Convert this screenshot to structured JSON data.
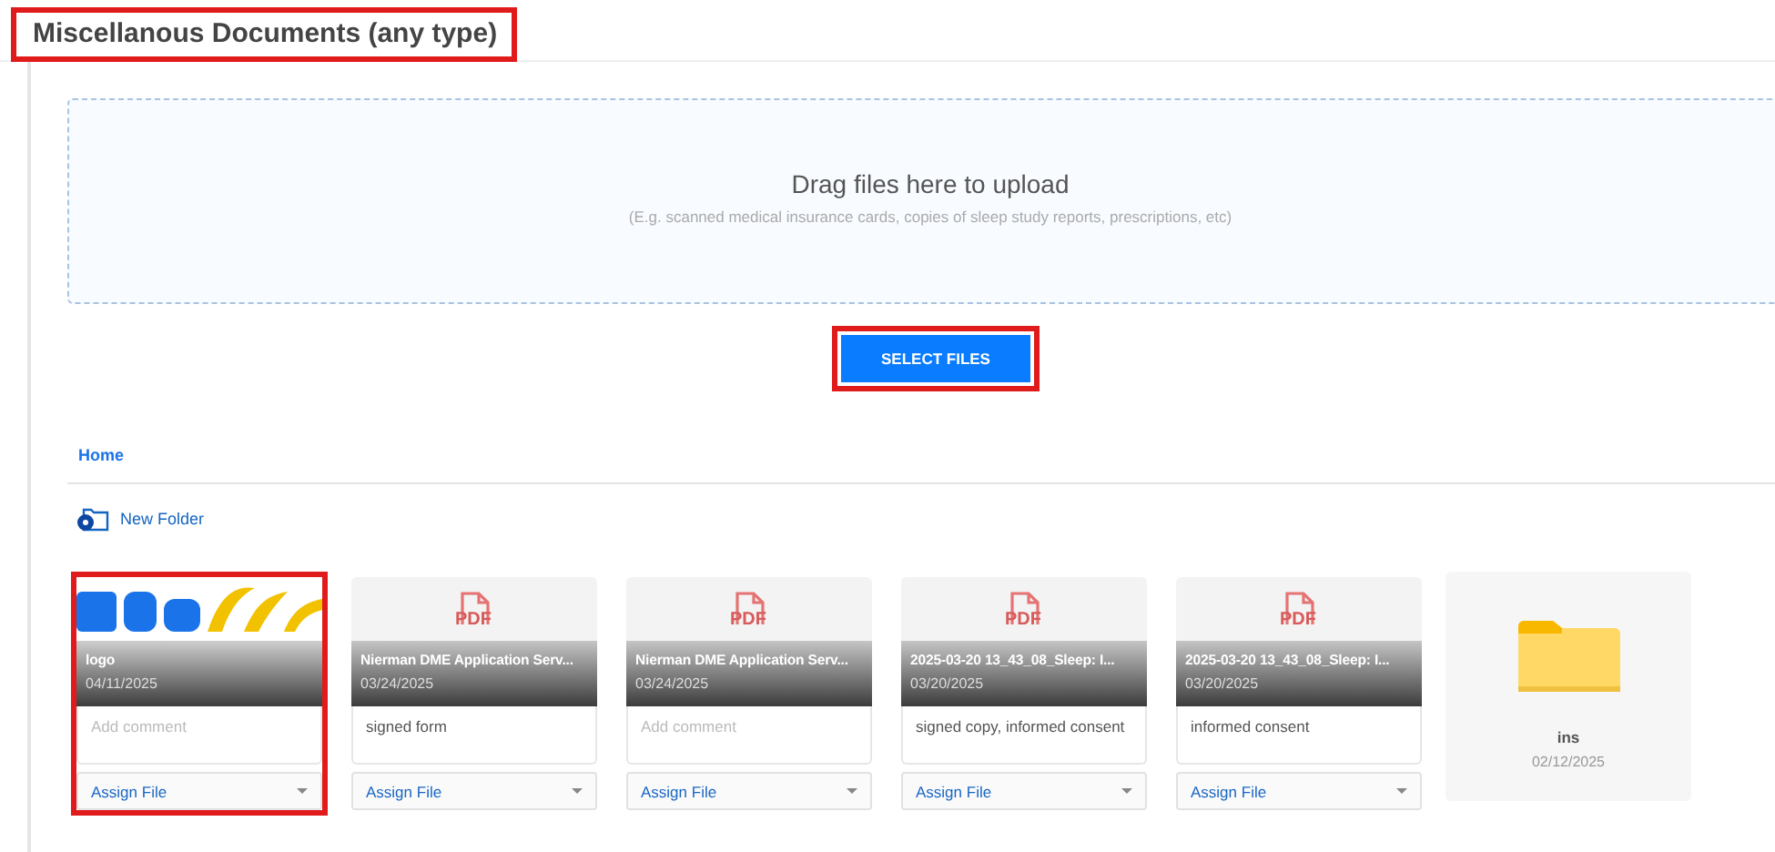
{
  "header": {
    "title": "Miscellanous Documents (any type)",
    "highlighted": true
  },
  "dropzone": {
    "heading": "Drag files here to upload",
    "hint": "(E.g. scanned medical insurance cards, copies of sleep study reports, prescriptions, etc)"
  },
  "select_button": {
    "label": "SELECT FILES",
    "highlighted": true
  },
  "breadcrumb": [
    "Home"
  ],
  "new_folder": {
    "label": "New Folder"
  },
  "files": [
    {
      "name": "logo",
      "date": "04/11/2025",
      "comment": {
        "placeholder": "Add comment"
      },
      "assign": "Assign File",
      "highlighted": true
    },
    {
      "kind": "pdf",
      "badge": "PDF",
      "name": "Nierman DME Application Serv...",
      "date": "03/24/2025",
      "comment": {
        "value": "signed form"
      },
      "assign": "Assign File",
      "highlighted": false
    },
    {
      "kind": "pdf",
      "badge": "PDF",
      "name": "Nierman DME Application Serv...",
      "date": "03/24/2025",
      "comment": {
        "placeholder": "Add comment"
      },
      "assign": "Assign File",
      "highlighted": false
    },
    {
      "kind": "pdf",
      "badge": "PDF",
      "name": "2025-03-20 13_43_08_Sleep: I...",
      "date": "03/20/2025",
      "comment": {
        "value": "signed copy, informed consent"
      },
      "assign": "Assign File",
      "highlighted": false
    },
    {
      "kind": "pdf",
      "badge": "PDF",
      "name": "2025-03-20 13_43_08_Sleep: I...",
      "date": "03/20/2025",
      "comment": {
        "value": "informed consent"
      },
      "assign": "Assign File",
      "highlighted": false
    },
    {
      "kind": "folder",
      "name": "ins",
      "date": "02/12/2025",
      "highlighted": false
    }
  ]
}
